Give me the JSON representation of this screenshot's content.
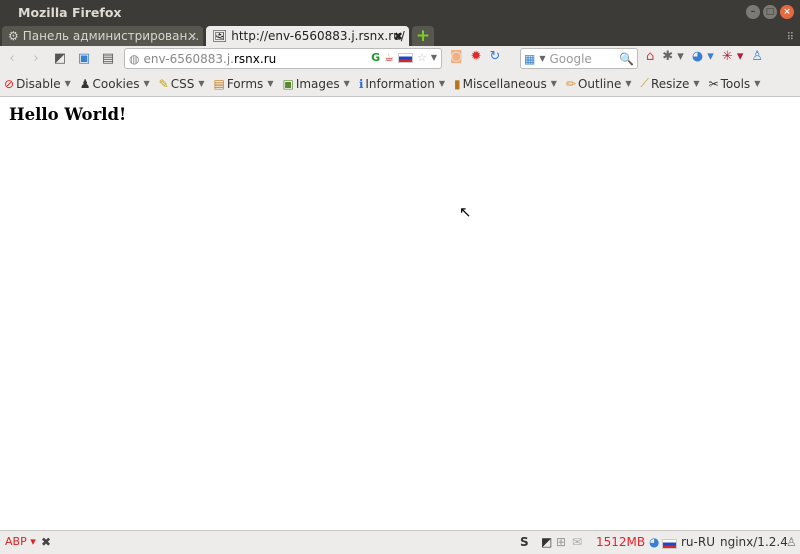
{
  "window": {
    "title": "Mozilla Firefox"
  },
  "tabs": [
    {
      "label": "Панель администрирован…",
      "active": false
    },
    {
      "label": "http://env-6560883.j.rsnx.ru/",
      "active": true
    }
  ],
  "urlbar": {
    "prefix": "env-6560883.j.",
    "domain": "rsnx.ru"
  },
  "search": {
    "placeholder": "Google"
  },
  "devtoolbar": [
    {
      "label": "Disable",
      "icon": "⊘",
      "color": "#d22"
    },
    {
      "label": "Cookies",
      "icon": "♟",
      "color": "#333"
    },
    {
      "label": "CSS",
      "icon": "✎",
      "color": "#c9a000"
    },
    {
      "label": "Forms",
      "icon": "▤",
      "color": "#c87a20"
    },
    {
      "label": "Images",
      "icon": "▣",
      "color": "#5a8a30"
    },
    {
      "label": "Information",
      "icon": "ℹ",
      "color": "#2a6ecf"
    },
    {
      "label": "Miscellaneous",
      "icon": "▮",
      "color": "#b8741a"
    },
    {
      "label": "Outline",
      "icon": "✏",
      "color": "#d8902a"
    },
    {
      "label": "Resize",
      "icon": "⟋",
      "color": "#c8903a"
    },
    {
      "label": "Tools",
      "icon": "✂",
      "color": "#444"
    }
  ],
  "page": {
    "heading": "Hello World!"
  },
  "statusbar": {
    "memory": "1512MB",
    "memory_color": "#e8202a",
    "locale": "ru-RU",
    "server": "nginx/1.2.4",
    "s_icon": "S"
  }
}
